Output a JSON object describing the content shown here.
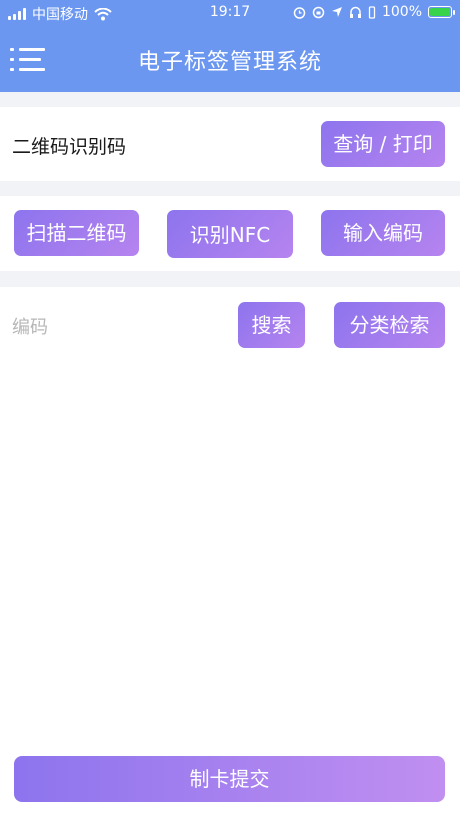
{
  "status_bar": {
    "carrier": "中国移动",
    "time": "19:17",
    "battery_text": "100%"
  },
  "navbar": {
    "title": "电子标签管理系统",
    "menu_icon": "menu-icon"
  },
  "qr_section": {
    "label": "二维码识别码",
    "query_button": "查询 / 打印"
  },
  "action_buttons": {
    "scan_qr": "扫描二维码",
    "identify_nfc": "识别NFC",
    "input_code": "输入编码"
  },
  "search_section": {
    "placeholder": "编码",
    "search_button": "搜索",
    "category_button": "分类检索"
  },
  "footer": {
    "submit_button": "制卡提交"
  },
  "colors": {
    "primary": "#6b97f0",
    "button_gradient_start": "#8d74ee",
    "button_gradient_end": "#b684ef",
    "battery": "#38d34a"
  }
}
